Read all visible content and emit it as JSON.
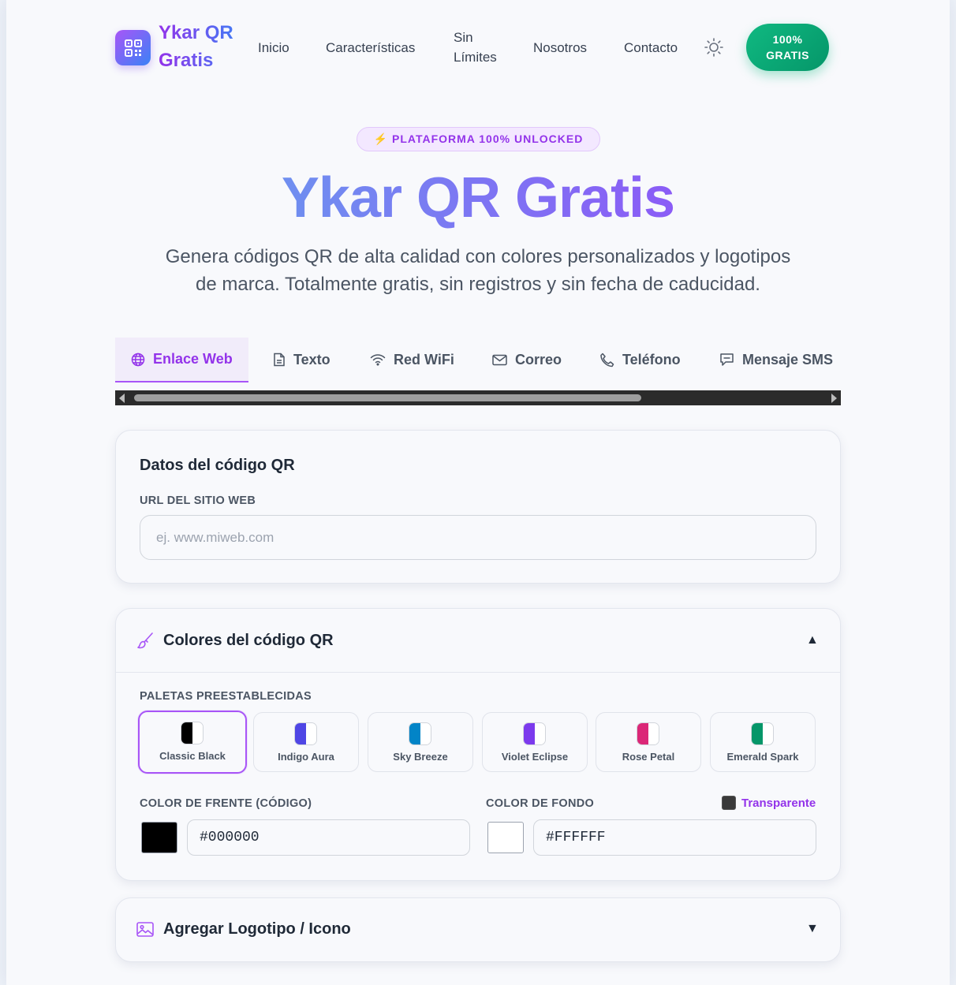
{
  "header": {
    "logo_line1": "Ykar QR",
    "logo_line2": "Gratis",
    "nav": [
      "Inicio",
      "Características",
      "Sin",
      "Límites",
      "Nosotros",
      "Contacto"
    ],
    "cta_line1": "100%",
    "cta_line2": "GRATIS"
  },
  "hero": {
    "badge": "⚡ PLATAFORMA 100% UNLOCKED",
    "title": "Ykar QR Gratis",
    "subtitle_line1": "Genera códigos QR de alta calidad con colores personalizados y logotipos",
    "subtitle_line2": "de marca. Totalmente gratis, sin registros y sin fecha de caducidad."
  },
  "tabs": [
    {
      "label": "Enlace Web",
      "icon": "globe-icon"
    },
    {
      "label": "Texto",
      "icon": "document-icon"
    },
    {
      "label": "Red WiFi",
      "icon": "wifi-icon"
    },
    {
      "label": "Correo",
      "icon": "mail-icon"
    },
    {
      "label": "Teléfono",
      "icon": "phone-icon"
    },
    {
      "label": "Mensaje SMS",
      "icon": "sms-icon"
    }
  ],
  "data_card": {
    "title": "Datos del código QR",
    "url_label": "URL DEL SITIO WEB",
    "url_value": "",
    "url_placeholder": "ej. www.miweb.com"
  },
  "colors_card": {
    "title": "Colores del código QR",
    "toggle": "▲",
    "palettes_label": "PALETAS PREESTABLECIDAS",
    "palettes": [
      {
        "name": "Classic Black",
        "fg": "#000000",
        "bg": "#FFFFFF",
        "selected": true
      },
      {
        "name": "Indigo Aura",
        "fg": "#4f46e5",
        "bg": "#FFFFFF",
        "selected": false
      },
      {
        "name": "Sky Breeze",
        "fg": "#0284c7",
        "bg": "#FFFFFF",
        "selected": false
      },
      {
        "name": "Violet Eclipse",
        "fg": "#7c3aed",
        "bg": "#FFFFFF",
        "selected": false
      },
      {
        "name": "Rose Petal",
        "fg": "#db2777",
        "bg": "#FFFFFF",
        "selected": false
      },
      {
        "name": "Emerald Spark",
        "fg": "#059669",
        "bg": "#FFFFFF",
        "selected": false
      }
    ],
    "fg_label": "COLOR DE FRENTE (CÓDIGO)",
    "fg_value": "#000000",
    "bg_label": "COLOR DE FONDO",
    "bg_value": "#FFFFFF",
    "transparent_label": "Transparente"
  },
  "logo_card": {
    "title": "Agregar Logotipo / Icono",
    "toggle": "▼"
  }
}
